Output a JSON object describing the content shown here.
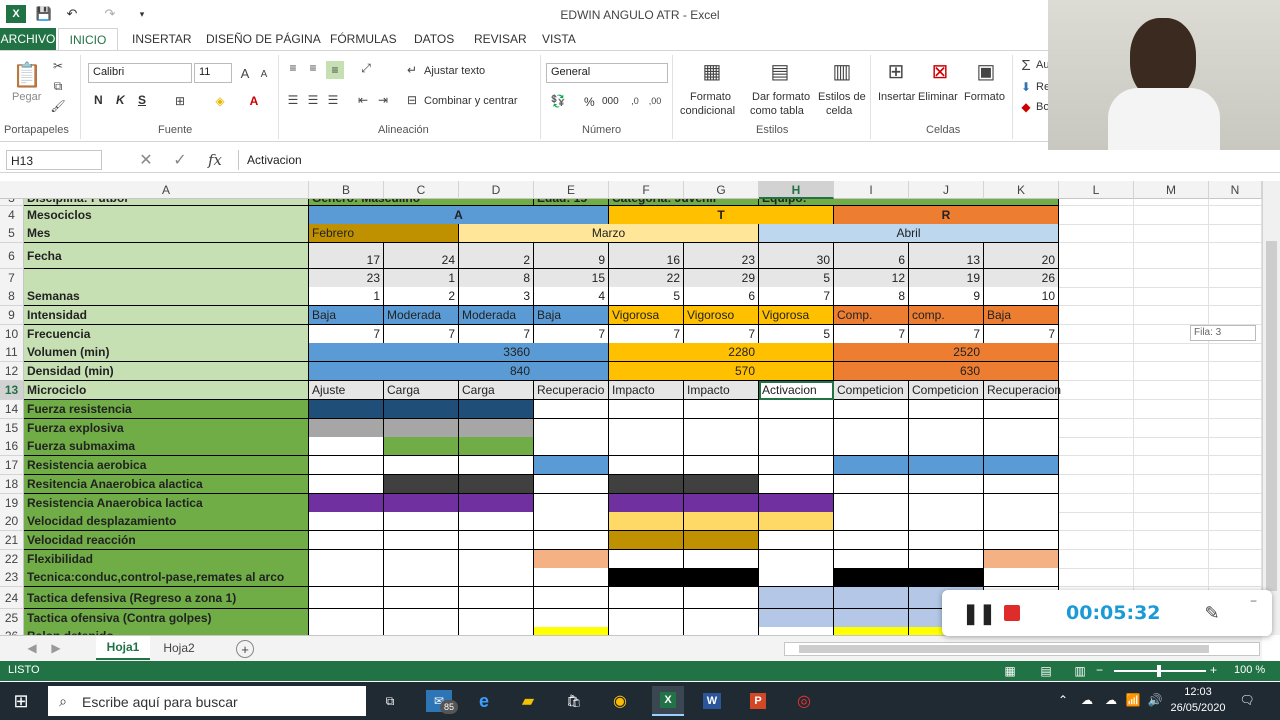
{
  "window": {
    "title": "EDWIN ANGULO ATR - Excel"
  },
  "ribbon_tabs": [
    "ARCHIVO",
    "INICIO",
    "INSERTAR",
    "DISEÑO DE PÁGINA",
    "FÓRMULAS",
    "DATOS",
    "REVISAR",
    "VISTA"
  ],
  "ribbon": {
    "paste": "Pegar",
    "group_clipboard": "Portapapeles",
    "font_name": "Calibri",
    "font_size": "11",
    "bold": "N",
    "italic": "K",
    "underline": "S",
    "group_font": "Fuente",
    "wrap": "Ajustar texto",
    "merge": "Combinar y centrar",
    "group_align": "Alineación",
    "numfmt": "General",
    "percent": "%",
    "thousands": "000",
    "group_number": "Número",
    "cond1": "Formato",
    "cond2": "condicional",
    "table1": "Dar formato",
    "table2": "como tabla",
    "styles1": "Estilos de",
    "styles2": "celda",
    "group_styles": "Estilos",
    "insert": "Insertar",
    "delete": "Eliminar",
    "format": "Formato",
    "group_cells": "Celdas",
    "edit1": "Au",
    "edit2": "Re",
    "edit3": "Bo"
  },
  "formula": {
    "namebox": "H13",
    "content": "Activacion",
    "fx": "fx"
  },
  "columns": [
    "A",
    "B",
    "C",
    "D",
    "E",
    "F",
    "G",
    "H",
    "I",
    "J",
    "K",
    "L",
    "M",
    "N"
  ],
  "colors": {
    "excel_green": "#217346",
    "blue": "#5b9bd5",
    "orange_y": "#ffc000",
    "orange": "#ed7d31",
    "green_label": "#70ad47",
    "light_green": "#c6e0b4"
  },
  "rows": [
    {
      "n": "3",
      "label": "Disciplina: Fútbol",
      "extra": [
        "Género: Masculino",
        "Edad: 15",
        "Categoría: Juvenil",
        "Equipo:"
      ]
    },
    {
      "n": "4",
      "label": "Mesociclos",
      "blocks": [
        "A",
        "T",
        "R"
      ]
    },
    {
      "n": "5",
      "label": "Mes",
      "months": [
        "Febrero",
        "Marzo",
        "Abril"
      ]
    },
    {
      "n": "6",
      "label": "Fecha",
      "vals": [
        "17",
        "24",
        "2",
        "9",
        "16",
        "23",
        "30",
        "6",
        "13",
        "20"
      ]
    },
    {
      "n": "7",
      "label": "",
      "vals": [
        "23",
        "1",
        "8",
        "15",
        "22",
        "29",
        "5",
        "12",
        "19",
        "26"
      ]
    },
    {
      "n": "8",
      "label": "Semanas",
      "vals": [
        "1",
        "2",
        "3",
        "4",
        "5",
        "6",
        "7",
        "8",
        "9",
        "10"
      ]
    },
    {
      "n": "9",
      "label": "Intensidad",
      "vals": [
        "Baja",
        "Moderada",
        "Moderada",
        "Baja",
        "Vigorosa",
        "Vigoroso",
        "Vigorosa",
        "Comp.",
        "comp.",
        "Baja"
      ]
    },
    {
      "n": "10",
      "label": "Frecuencia",
      "vals": [
        "7",
        "7",
        "7",
        "7",
        "7",
        "7",
        "5",
        "7",
        "7",
        "7"
      ]
    },
    {
      "n": "11",
      "label": "Volumen (min)",
      "groups": [
        "3360",
        "2280",
        "2520"
      ]
    },
    {
      "n": "12",
      "label": "Densidad  (min)",
      "groups": [
        "840",
        "570",
        "630"
      ]
    },
    {
      "n": "13",
      "label": "Microciclo",
      "vals": [
        "Ajuste",
        "Carga",
        "Carga",
        "Recuperacio",
        "Impacto",
        "Impacto",
        "Activacion",
        "Competicion",
        "Competicion",
        "Recuperacion"
      ]
    },
    {
      "n": "14",
      "label": "Fuerza resistencia"
    },
    {
      "n": "15",
      "label": "Fuerza explosiva"
    },
    {
      "n": "16",
      "label": "Fuerza submaxima"
    },
    {
      "n": "17",
      "label": "Resistencia aerobica"
    },
    {
      "n": "18",
      "label": "Resitencia Anaerobica alactica"
    },
    {
      "n": "19",
      "label": "Resistencia Anaerobica lactica"
    },
    {
      "n": "20",
      "label": "Velocidad desplazamiento"
    },
    {
      "n": "21",
      "label": "Velocidad reacción"
    },
    {
      "n": "22",
      "label": "Flexibilidad"
    },
    {
      "n": "23",
      "label": "Tecnica:conduc,control-pase,remates al arco"
    },
    {
      "n": "24",
      "label": "Tactica defensiva (Regreso a zona 1)"
    },
    {
      "n": "25",
      "label": "Tactica ofensiva (Contra golpes)"
    },
    {
      "n": "26",
      "label": "Balon detenido"
    }
  ],
  "fill_map": {
    "14": {
      "cols": [
        0,
        1,
        2
      ],
      "color": "#1f4e79"
    },
    "15": {
      "cols": [
        0,
        1,
        2
      ],
      "color": "#a6a6a6"
    },
    "16": {
      "cols": [
        1,
        2
      ],
      "color": "#70ad47"
    },
    "17": {
      "cols": [
        3,
        7,
        8,
        9
      ],
      "color": "#5b9bd5"
    },
    "18": {
      "cols": [
        1,
        2,
        4,
        5
      ],
      "color": "#404040"
    },
    "19": {
      "cols": [
        0,
        1,
        2,
        4,
        5,
        6
      ],
      "color": "#7030a0"
    },
    "20": {
      "cols": [
        4,
        5,
        6
      ],
      "color": "#ffd966"
    },
    "21": {
      "cols": [
        4,
        5
      ],
      "color": "#bf9000"
    },
    "22": {
      "cols": [
        3,
        9
      ],
      "color": "#f4b183"
    },
    "23": {
      "cols": [
        4,
        5,
        7,
        8
      ],
      "color": "#000000"
    },
    "24": {
      "cols": [
        6,
        7,
        8
      ],
      "color": "#b4c7e7"
    },
    "25": {
      "cols": [
        6,
        7,
        8
      ],
      "color": "#b4c7e7"
    },
    "26": {
      "cols": [
        3,
        7,
        8
      ],
      "color": "#ffff00"
    }
  },
  "tooltip": "Fila: 3",
  "sheets": [
    "Hoja1",
    "Hoja2"
  ],
  "status": {
    "mode": "LISTO",
    "zoom": "100 %"
  },
  "recorder": {
    "time": "00:05:32"
  },
  "taskbar": {
    "search": "Escribe aquí para buscar",
    "mail_badge": "85",
    "time": "12:03",
    "date": "26/05/2020"
  }
}
